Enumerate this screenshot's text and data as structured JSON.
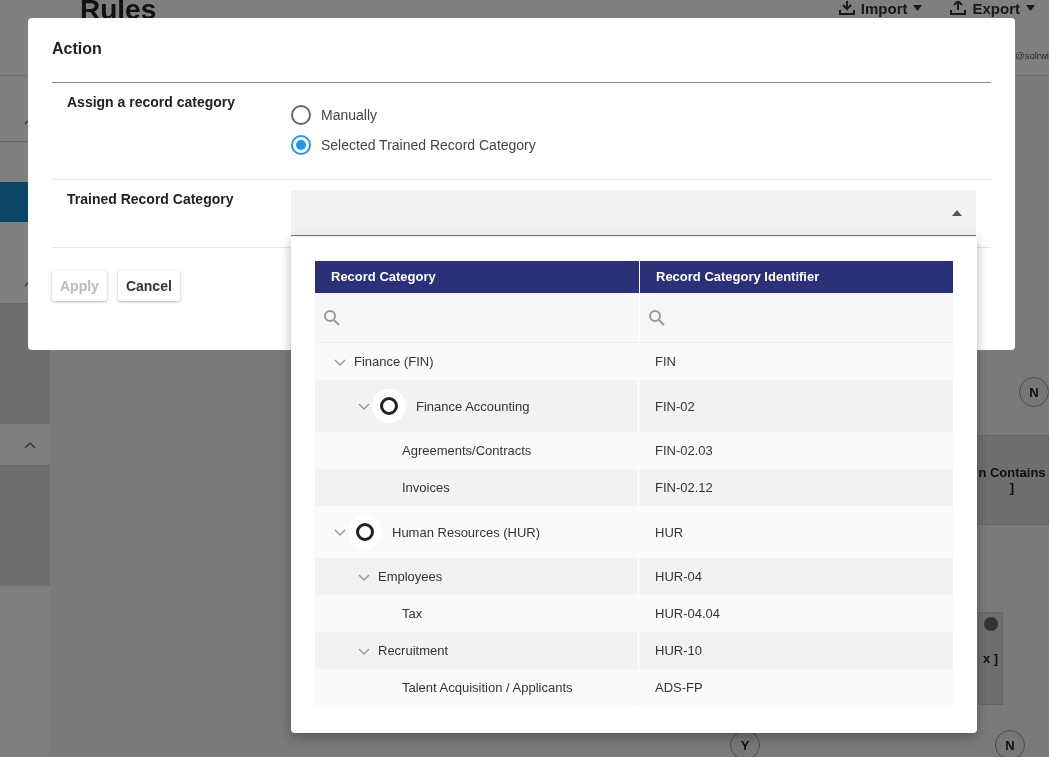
{
  "background": {
    "page_title": "Rules",
    "header_buttons": [
      {
        "label": "Import"
      },
      {
        "label": "Export"
      }
    ],
    "user_text": "@solrwi",
    "canvas_nodes": [
      {
        "kind": "decision",
        "label": "N"
      },
      {
        "kind": "condition",
        "lines": [
          "n Contains",
          "]"
        ],
        "closable": false
      },
      {
        "kind": "condition",
        "lines": [
          "x ]"
        ],
        "closable": true
      },
      {
        "kind": "decision",
        "label": "Y"
      },
      {
        "kind": "decision",
        "label": "N"
      }
    ]
  },
  "modal": {
    "title": "Action",
    "fields": [
      {
        "kind": "radio",
        "label": "Assign a record category",
        "options": [
          {
            "label": "Manually",
            "selected": false
          },
          {
            "label": "Selected Trained Record Category",
            "selected": true
          }
        ]
      },
      {
        "kind": "select",
        "label": "Trained Record Category",
        "expanded": true
      }
    ],
    "buttons": [
      {
        "label": "Apply",
        "disabled": true
      },
      {
        "label": "Cancel",
        "disabled": false
      }
    ]
  },
  "dropdown": {
    "columns": [
      "Record Category",
      "Record Category Identifier"
    ],
    "rows": [
      {
        "name": "Finance (FIN)",
        "id": "FIN",
        "expanded": true,
        "ring": false,
        "children": [
          {
            "name": "Finance Accounting",
            "id": "FIN-02",
            "expanded": true,
            "ring": true,
            "children": [
              {
                "name": "Agreements/Contracts",
                "id": "FIN-02.03",
                "ring": false
              },
              {
                "name": "Invoices",
                "id": "FIN-02.12",
                "ring": false
              }
            ]
          }
        ]
      },
      {
        "name": "Human Resources (HUR)",
        "id": "HUR",
        "expanded": true,
        "ring": true,
        "children": [
          {
            "name": "Employees",
            "id": "HUR-04",
            "expanded": true,
            "ring": false,
            "children": [
              {
                "name": "Tax",
                "id": "HUR-04.04",
                "ring": false
              }
            ]
          },
          {
            "name": "Recruitment",
            "id": "HUR-10",
            "expanded": true,
            "ring": false,
            "children": [
              {
                "name": "Talent Acquisition / Applicants",
                "id": "ADS-FP",
                "ring": false
              }
            ]
          }
        ]
      }
    ]
  }
}
